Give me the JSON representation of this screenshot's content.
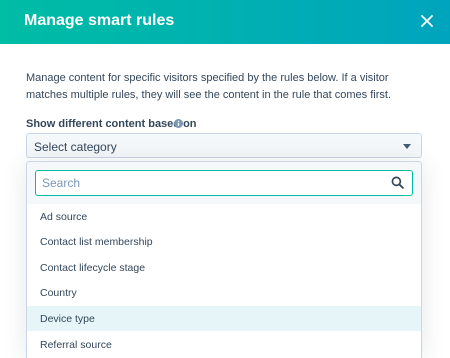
{
  "modal": {
    "title": "Manage smart rules",
    "description": "Manage content for specific visitors specified by the rules below. If a visitor matches multiple rules, they will see the content in the rule that comes first.",
    "field_label": "Show different content based on",
    "select": {
      "value": "Select category"
    },
    "search": {
      "placeholder": "Search",
      "value": ""
    },
    "options": [
      "Ad source",
      "Contact list membership",
      "Contact lifecycle stage",
      "Country",
      "Device type",
      "Referral source"
    ],
    "highlighted_option": "Device type"
  },
  "colors": {
    "header_start": "#00bda5",
    "header_end": "#00a4bd",
    "focus_border": "#00bda5",
    "highlight_bg": "#e5f5f8",
    "text": "#33475b"
  },
  "icons": [
    "close-icon",
    "info-icon",
    "chevron-down-icon",
    "search-icon"
  ]
}
